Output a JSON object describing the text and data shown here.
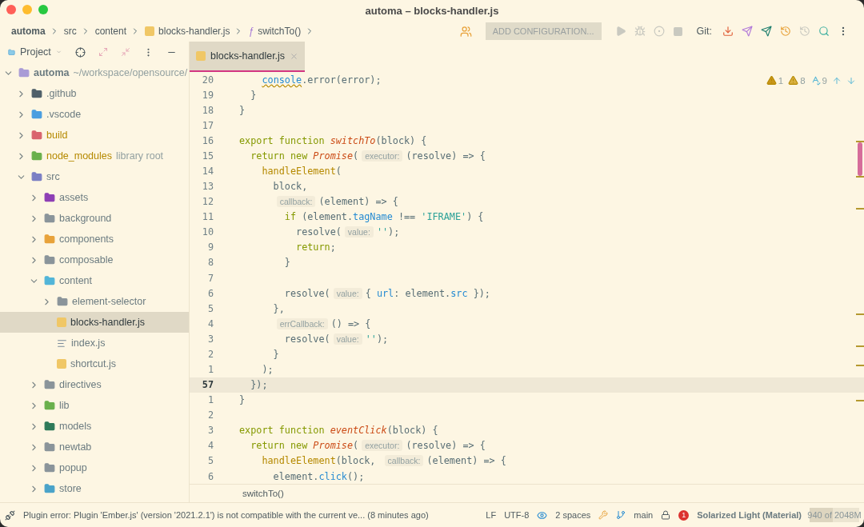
{
  "window": {
    "title": "automa – blocks-handler.js"
  },
  "breadcrumbs": [
    {
      "label": "automa",
      "kind": "project"
    },
    {
      "label": "src",
      "kind": "folder"
    },
    {
      "label": "content",
      "kind": "folder"
    },
    {
      "label": "blocks-handler.js",
      "kind": "js"
    },
    {
      "label": "switchTo()",
      "kind": "function",
      "glyph": "ƒ"
    }
  ],
  "toolbar": {
    "configuration": "ADD CONFIGURATION...",
    "git_label": "Git:"
  },
  "project_panel": {
    "title": "Project"
  },
  "tree": [
    {
      "name": "automa",
      "note": "~/workspace/opensource/",
      "kind": "folder",
      "color": "#a99bd6",
      "expanded": true,
      "selected": false,
      "excluded": false,
      "children": [
        {
          "name": ".github",
          "kind": "folder",
          "color": "#4f5f69",
          "expanded": false,
          "selected": false,
          "excluded": false
        },
        {
          "name": ".vscode",
          "kind": "folder",
          "color": "#4a9ee0",
          "expanded": false,
          "selected": false,
          "excluded": false
        },
        {
          "name": "build",
          "kind": "folder",
          "color": "#d9646e",
          "expanded": false,
          "selected": false,
          "excluded": true
        },
        {
          "name": "node_modules",
          "note": "library root",
          "kind": "folder",
          "color": "#6ab04c",
          "expanded": false,
          "selected": false,
          "excluded": true
        },
        {
          "name": "src",
          "kind": "folder",
          "color": "#7b7fc4",
          "expanded": true,
          "selected": false,
          "excluded": false,
          "children": [
            {
              "name": "assets",
              "kind": "folder",
              "color": "#8e3fb5",
              "expanded": false,
              "selected": false,
              "excluded": false
            },
            {
              "name": "background",
              "kind": "folder",
              "color": "#8a949a",
              "expanded": false,
              "selected": false,
              "excluded": false
            },
            {
              "name": "components",
              "kind": "folder",
              "color": "#e8a23a",
              "expanded": false,
              "selected": false,
              "excluded": false
            },
            {
              "name": "composable",
              "kind": "folder",
              "color": "#8a949a",
              "expanded": false,
              "selected": false,
              "excluded": false
            },
            {
              "name": "content",
              "kind": "folder",
              "color": "#52b5d8",
              "expanded": true,
              "selected": false,
              "excluded": false,
              "children": [
                {
                  "name": "element-selector",
                  "kind": "folder",
                  "color": "#8a949a",
                  "expanded": false,
                  "selected": false,
                  "excluded": false
                },
                {
                  "name": "blocks-handler.js",
                  "kind": "js",
                  "selected": true,
                  "excluded": false
                },
                {
                  "name": "index.js",
                  "kind": "text",
                  "selected": false,
                  "excluded": false
                },
                {
                  "name": "shortcut.js",
                  "kind": "js",
                  "selected": false,
                  "excluded": false
                }
              ]
            },
            {
              "name": "directives",
              "kind": "folder",
              "color": "#8a949a",
              "expanded": false,
              "selected": false,
              "excluded": false
            },
            {
              "name": "lib",
              "kind": "folder",
              "color": "#6ab04c",
              "expanded": false,
              "selected": false,
              "excluded": false
            },
            {
              "name": "models",
              "kind": "folder",
              "color": "#2e7a5a",
              "expanded": false,
              "selected": false,
              "excluded": false
            },
            {
              "name": "newtab",
              "kind": "folder",
              "color": "#8a949a",
              "expanded": false,
              "selected": false,
              "excluded": false
            },
            {
              "name": "popup",
              "kind": "folder",
              "color": "#8a949a",
              "expanded": false,
              "selected": false,
              "excluded": false
            },
            {
              "name": "store",
              "kind": "folder",
              "color": "#4aa3c9",
              "expanded": false,
              "selected": false,
              "excluded": false
            }
          ]
        }
      ]
    }
  ],
  "tabs": [
    {
      "label": "blocks-handler.js",
      "selected": true
    }
  ],
  "inspections": [
    {
      "kind": "error",
      "count": "1"
    },
    {
      "kind": "warning",
      "count": "8"
    },
    {
      "kind": "typo",
      "count": "9"
    }
  ],
  "code_lines": [
    {
      "number": "20",
      "current": false,
      "tokens": [
        {
          "kind": "warn",
          "text": "    console"
        },
        {
          "kind": "text",
          "text": ".error(error);"
        }
      ]
    },
    {
      "number": "19",
      "current": false,
      "tokens": [
        {
          "kind": "text",
          "text": "  }"
        }
      ]
    },
    {
      "number": "18",
      "current": false,
      "tokens": [
        {
          "kind": "text",
          "text": "}"
        }
      ]
    },
    {
      "number": "17",
      "current": false
    },
    {
      "number": "16",
      "current": false,
      "tokens": [
        {
          "kind": "kw",
          "text": "export function "
        },
        {
          "kind": "fn",
          "text": "switchTo"
        },
        {
          "kind": "text",
          "text": "(block) {"
        }
      ]
    },
    {
      "number": "15",
      "current": false,
      "tokens": [
        {
          "kind": "kw",
          "text": "  return new "
        },
        {
          "kind": "fn",
          "text": "Promise"
        },
        {
          "kind": "text",
          "text": "("
        },
        {
          "kind": "hint",
          "text": "executor:"
        },
        {
          "kind": "text",
          "text": "(resolve) => {"
        }
      ]
    },
    {
      "number": "14",
      "current": false,
      "tokens": [
        {
          "kind": "call",
          "text": "    handleElement"
        },
        {
          "kind": "text",
          "text": "("
        }
      ]
    },
    {
      "number": "13",
      "current": false,
      "tokens": [
        {
          "kind": "text",
          "text": "      block,"
        }
      ]
    },
    {
      "number": "12",
      "current": false,
      "tokens": [
        {
          "kind": "hint",
          "text": "      callback:"
        },
        {
          "kind": "text",
          "text": "(element) => {"
        }
      ]
    },
    {
      "number": "11",
      "current": false,
      "tokens": [
        {
          "kind": "kw",
          "text": "        if "
        },
        {
          "kind": "text",
          "text": "(element."
        },
        {
          "kind": "prop",
          "text": "tagName"
        },
        {
          "kind": "text",
          "text": " !== "
        },
        {
          "kind": "str",
          "text": "'IFRAME'"
        },
        {
          "kind": "text",
          "text": ") {"
        }
      ]
    },
    {
      "number": "10",
      "current": false,
      "tokens": [
        {
          "kind": "text",
          "text": "          resolve("
        },
        {
          "kind": "hint",
          "text": "value:"
        },
        {
          "kind": "str",
          "text": "''"
        },
        {
          "kind": "text",
          "text": ");"
        }
      ]
    },
    {
      "number": "9",
      "current": false,
      "tokens": [
        {
          "kind": "kw",
          "text": "          return"
        },
        {
          "kind": "text",
          "text": ";"
        }
      ]
    },
    {
      "number": "8",
      "current": false,
      "tokens": [
        {
          "kind": "text",
          "text": "        }"
        }
      ]
    },
    {
      "number": "7",
      "current": false
    },
    {
      "number": "6",
      "current": false,
      "tokens": [
        {
          "kind": "text",
          "text": "        resolve("
        },
        {
          "kind": "hint",
          "text": "value:"
        },
        {
          "kind": "text",
          "text": "{ "
        },
        {
          "kind": "prop",
          "text": "url"
        },
        {
          "kind": "text",
          "text": ": element."
        },
        {
          "kind": "prop",
          "text": "src"
        },
        {
          "kind": "text",
          "text": " });"
        }
      ]
    },
    {
      "number": "5",
      "current": false,
      "tokens": [
        {
          "kind": "text",
          "text": "      },"
        }
      ]
    },
    {
      "number": "4",
      "current": false,
      "tokens": [
        {
          "kind": "hint",
          "text": "      errCallback:"
        },
        {
          "kind": "text",
          "text": "() => {"
        }
      ]
    },
    {
      "number": "3",
      "current": false,
      "tokens": [
        {
          "kind": "text",
          "text": "        resolve("
        },
        {
          "kind": "hint",
          "text": "value:"
        },
        {
          "kind": "str",
          "text": "''"
        },
        {
          "kind": "text",
          "text": ");"
        }
      ]
    },
    {
      "number": "2",
      "current": false,
      "tokens": [
        {
          "kind": "text",
          "text": "      }"
        }
      ]
    },
    {
      "number": "1",
      "current": false,
      "tokens": [
        {
          "kind": "text",
          "text": "    );"
        }
      ]
    },
    {
      "number": "57",
      "current": true,
      "tokens": [
        {
          "kind": "text",
          "text": "  });"
        }
      ]
    },
    {
      "number": "1",
      "current": false,
      "tokens": [
        {
          "kind": "text",
          "text": "}"
        }
      ]
    },
    {
      "number": "2",
      "current": false
    },
    {
      "number": "3",
      "current": false,
      "tokens": [
        {
          "kind": "kw",
          "text": "export function "
        },
        {
          "kind": "fn",
          "text": "eventClick"
        },
        {
          "kind": "text",
          "text": "(block) {"
        }
      ]
    },
    {
      "number": "4",
      "current": false,
      "tokens": [
        {
          "kind": "kw",
          "text": "  return new "
        },
        {
          "kind": "fn",
          "text": "Promise"
        },
        {
          "kind": "text",
          "text": "("
        },
        {
          "kind": "hint",
          "text": "executor:"
        },
        {
          "kind": "text",
          "text": "(resolve) => {"
        }
      ]
    },
    {
      "number": "5",
      "current": false,
      "tokens": [
        {
          "kind": "call",
          "text": "    handleElement"
        },
        {
          "kind": "text",
          "text": "(block, "
        },
        {
          "kind": "hint",
          "text": "callback:"
        },
        {
          "kind": "text",
          "text": "(element) => {"
        }
      ]
    },
    {
      "number": "6",
      "current": false,
      "tokens": [
        {
          "kind": "text",
          "text": "      element."
        },
        {
          "kind": "prop",
          "text": "click"
        },
        {
          "kind": "text",
          "text": "();"
        }
      ]
    }
  ],
  "editor_breadcrumb": "switchTo()",
  "status_bar": {
    "message": "Plugin error: Plugin 'Ember.js' (version '2021.2.1') is not compatible with the current ve... (8 minutes ago)",
    "line_separator": "LF",
    "encoding": "UTF-8",
    "indent": "2 spaces",
    "branch": "main",
    "theme_badge": "1",
    "theme": "Solarized Light (Material)",
    "memory": {
      "text": "940 of 2048M",
      "level": 0.46
    }
  }
}
